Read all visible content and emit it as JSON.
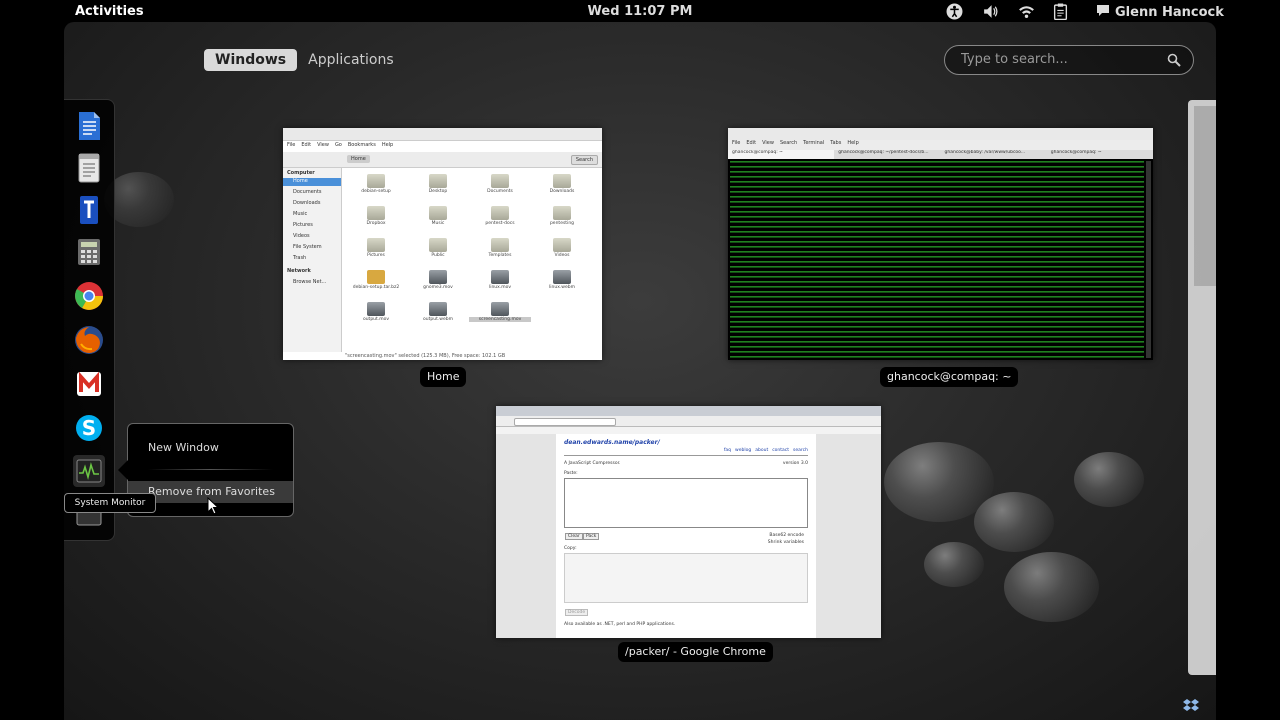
{
  "topbar": {
    "activities": "Activities",
    "clock": "Wed 11:07 PM",
    "user": "Glenn Hancock",
    "tray_icons": [
      "accessibility-icon",
      "volume-icon",
      "wifi-icon",
      "clipboard-icon",
      "chat-icon"
    ]
  },
  "overview": {
    "tabs": [
      {
        "label": "Windows",
        "active": true
      },
      {
        "label": "Applications",
        "active": false
      }
    ],
    "search": {
      "placeholder": "Type to search..."
    }
  },
  "dash": {
    "items": [
      "document-app-icon",
      "text-editor-icon",
      "presentation-icon",
      "calculator-icon",
      "chrome-icon",
      "firefox-icon",
      "gmail-icon",
      "skype-icon",
      "system-monitor-icon",
      "terminal-icon"
    ]
  },
  "context_menu": {
    "items": [
      "New Window",
      "Remove from Favorites"
    ]
  },
  "tooltip": "System Monitor",
  "windows": {
    "home": {
      "caption": "Home",
      "menu": [
        "File",
        "Edit",
        "View",
        "Go",
        "Bookmarks",
        "Help"
      ],
      "location": "Home",
      "search_btn": "Search",
      "sidebar_header_computer": "Computer",
      "sidebar": [
        "Home",
        "Documents",
        "Downloads",
        "Music",
        "Pictures",
        "Videos",
        "File System",
        "Trash"
      ],
      "sidebar_header_network": "Network",
      "network": [
        "Browse Net..."
      ],
      "files": [
        "debian-setup",
        "Desktop",
        "Documents",
        "Downloads",
        "Dropbox",
        "Music",
        "pentest-docs",
        "pentesting",
        "Pictures",
        "Public",
        "Templates",
        "Videos",
        "debian-setup.tar.bz2",
        "gnome3.mov",
        "linux.mov",
        "linux.webm",
        "output.mov",
        "output.webm",
        "screencasting.mov"
      ],
      "status": "\"screencasting.mov\" selected (125.3 MB), Free space: 102.1 GB"
    },
    "terminal": {
      "caption": "ghancock@compaq: ~",
      "menu": [
        "File",
        "Edit",
        "View",
        "Search",
        "Terminal",
        "Tabs",
        "Help"
      ],
      "tabs": [
        "ghancock@compaq: ~",
        "ghancock@compaq: ~/pentest-docs/b...",
        "ghancock@baby: /var/www/ubcoo...",
        "ghancock@compaq: ~"
      ]
    },
    "chrome": {
      "caption": "/packer/ - Google Chrome",
      "page_title": "dean.edwards.name/packer/",
      "nav_links": [
        "faq",
        "weblog",
        "about",
        "contact",
        "search"
      ],
      "subtitle": "A JavaScript Compressor.",
      "version": "version 3.0",
      "paste_label": "Paste:",
      "copy_label": "Copy:",
      "btn_clear": "Clear",
      "btn_pack": "Pack",
      "opt_base62": "Base62 encode",
      "opt_shrink": "Shrink variables",
      "btn_decode": "Decode",
      "footer": "Also available as .NET, perl and PHP applications."
    }
  },
  "colors": {
    "accent_green": "#6cc644",
    "terminal_text": "#3bd63b"
  }
}
